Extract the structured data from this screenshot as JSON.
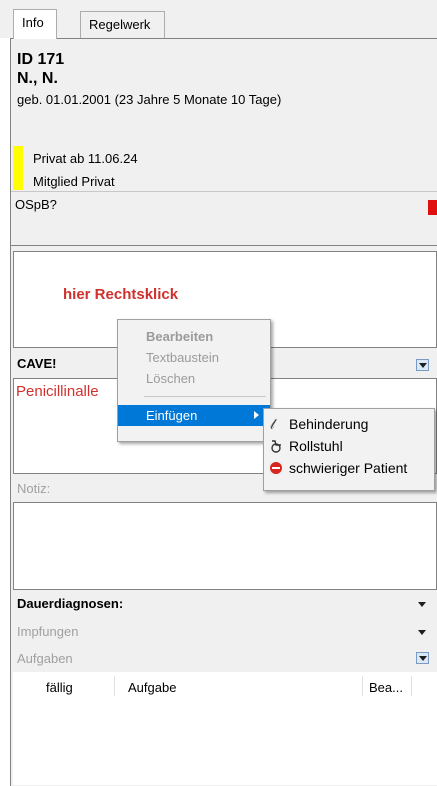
{
  "tabs": [
    {
      "label": "Info"
    },
    {
      "label": "Regelwerk"
    }
  ],
  "patient": {
    "id": "ID 171",
    "name": "N., N.",
    "birth": "geb. 01.01.2001 (23 Jahre 5 Monate 10 Tage)",
    "insurance_line1": "Privat ab 11.06.24",
    "insurance_line2": "Mitglied Privat",
    "ospb": "OSpB?"
  },
  "hint": "hier Rechtsklick",
  "cave": {
    "label": "CAVE!",
    "text": "Penicillinalle"
  },
  "notiz": {
    "label": "Notiz:"
  },
  "sections": [
    {
      "label": "Dauerdiagnosen:"
    },
    {
      "label": "Impfungen"
    },
    {
      "label": "Aufgaben"
    }
  ],
  "aufgaben_table": {
    "columns": [
      "fällig",
      "Aufgabe",
      "Bea..."
    ]
  },
  "context_menu": {
    "items": [
      "Bearbeiten",
      "Textbaustein",
      "Löschen",
      "Einfügen"
    ]
  },
  "submenu": {
    "items": [
      {
        "label": "Behinderung",
        "icon": "wheelchair-sign-icon"
      },
      {
        "label": "Rollstuhl",
        "icon": "wheelchair-icon"
      },
      {
        "label": "schwieriger Patient",
        "icon": "stop-sign-icon"
      }
    ]
  },
  "colors": {
    "hint_red": "#d0312d",
    "highlight": "#0078d7",
    "yellow": "#ffff00"
  }
}
